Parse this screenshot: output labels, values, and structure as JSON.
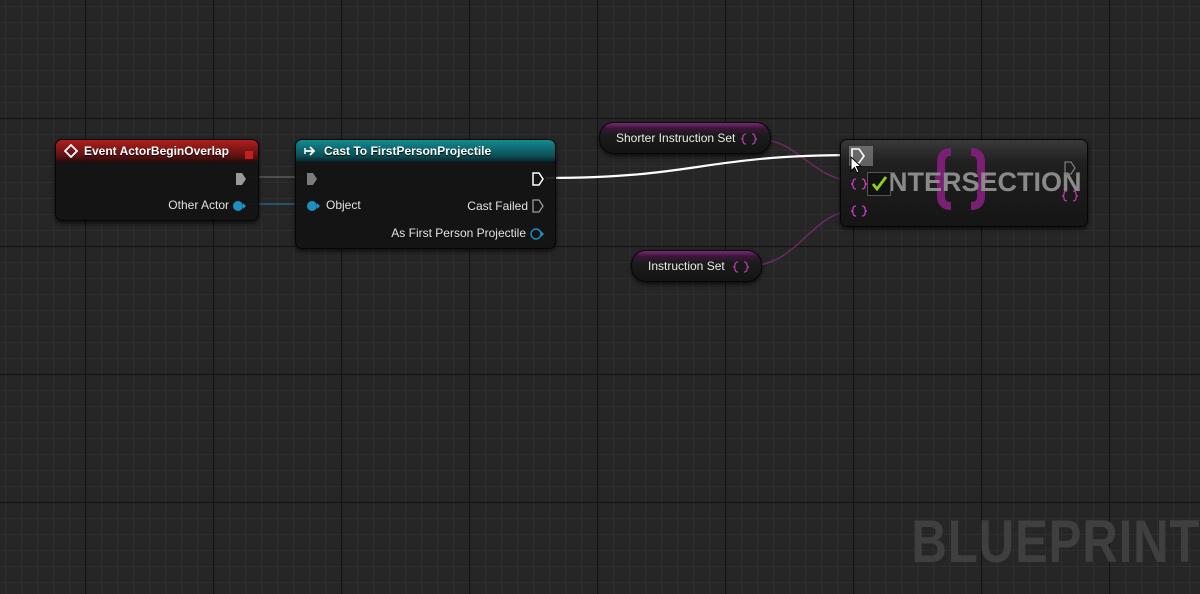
{
  "nodes": {
    "event_overlap": {
      "title": "Event ActorBeginOverlap",
      "pin_other_actor": "Other Actor"
    },
    "cast_node": {
      "title": "Cast To FirstPersonProjectile",
      "pin_object": "Object",
      "pin_cast_failed": "Cast Failed",
      "pin_as_projectile": "As First Person Projectile"
    },
    "var_shorter": {
      "label": "Shorter Instruction Set"
    },
    "var_instruction": {
      "label": "Instruction Set"
    },
    "intersection": {
      "title": "NTERSECTION",
      "checkbox_checked": true
    }
  },
  "watermark": "BLUEPRINT",
  "colors": {
    "event_header": "#b21e1e",
    "cast_header": "#138a92",
    "set_pin": "#c93bc0",
    "object_pin": "#1f8fbd",
    "exec_wire": "#ffffff",
    "check": "#8fd11f"
  },
  "icons": [
    "event-diamond-icon",
    "cast-arrow-icon",
    "exec-pin-icon",
    "object-pin-icon",
    "set-pin-icon",
    "checkmark-icon",
    "mouse-cursor-icon"
  ]
}
